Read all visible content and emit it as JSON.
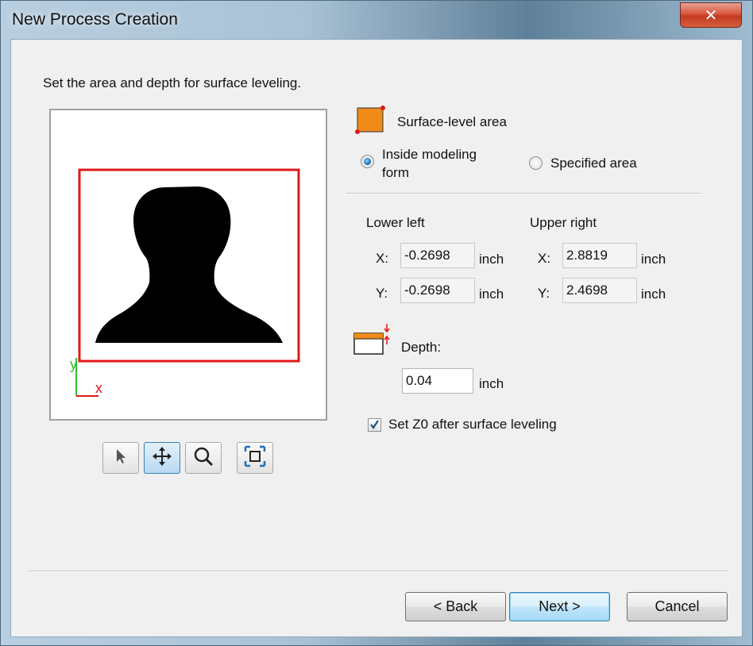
{
  "window": {
    "title": "New Process Creation",
    "close_glyph": "✕"
  },
  "instruction": "Set the area and depth for surface leveling.",
  "preview": {
    "axis_x": "x",
    "axis_y": "y",
    "colors": {
      "area_frame": "#e01818",
      "silhouette": "#000000",
      "axis_x": "#e01818",
      "axis_y": "#2fbf2f"
    }
  },
  "tools": [
    {
      "name": "select-tool-button",
      "icon": "arrow-pointer-icon",
      "active": false
    },
    {
      "name": "pan-tool-button",
      "icon": "move-arrows-icon",
      "active": true
    },
    {
      "name": "zoom-tool-button",
      "icon": "magnifier-icon",
      "active": false
    },
    {
      "name": "fit-tool-button",
      "icon": "fit-view-icon",
      "active": false
    }
  ],
  "surface_area": {
    "label": "Surface-level area",
    "icon": "orange-area-icon",
    "options": [
      {
        "label_line1": "Inside modeling",
        "label_line2": "form",
        "checked": true
      },
      {
        "label": "Specified area",
        "checked": false
      }
    ]
  },
  "coords": {
    "lower_left_label": "Lower left",
    "upper_right_label": "Upper right",
    "x_label": "X:",
    "y_label": "Y:",
    "unit": "inch",
    "lower_left": {
      "x": "-0.2698",
      "y": "-0.2698"
    },
    "upper_right": {
      "x": "2.8819",
      "y": "2.4698"
    }
  },
  "depth": {
    "label": "Depth:",
    "value": "0.04",
    "unit": "inch",
    "icon": "depth-icon"
  },
  "set_z0": {
    "label": "Set Z0 after surface leveling",
    "checked": true
  },
  "buttons": {
    "back": "< Back",
    "next": "Next >",
    "cancel": "Cancel"
  },
  "colors": {
    "accent": "#3c7fb1",
    "orange": "#f08a18"
  }
}
